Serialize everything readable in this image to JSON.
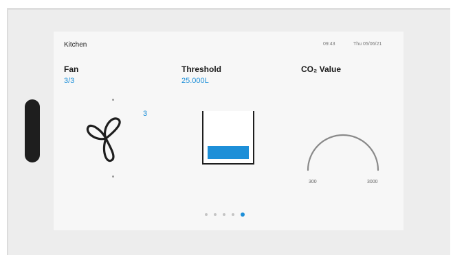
{
  "topbar": {
    "room": "Kitchen",
    "time": "09:43",
    "date": "Thu 05/06/21"
  },
  "fan": {
    "title": "Fan",
    "value": "3/3",
    "level_label": "3",
    "icon": "fan-icon"
  },
  "threshold": {
    "title": "Threshold",
    "value": "25.000L",
    "fill_fraction": 0.3
  },
  "co2": {
    "title": "CO₂ Value",
    "min_label": "300",
    "max_label": "3000"
  },
  "pager": {
    "count": 5,
    "active_index": 4
  },
  "colors": {
    "accent": "#1d8fd8",
    "text": "#1a1a1a",
    "device": "#ededed",
    "screen": "#f7f7f7"
  }
}
